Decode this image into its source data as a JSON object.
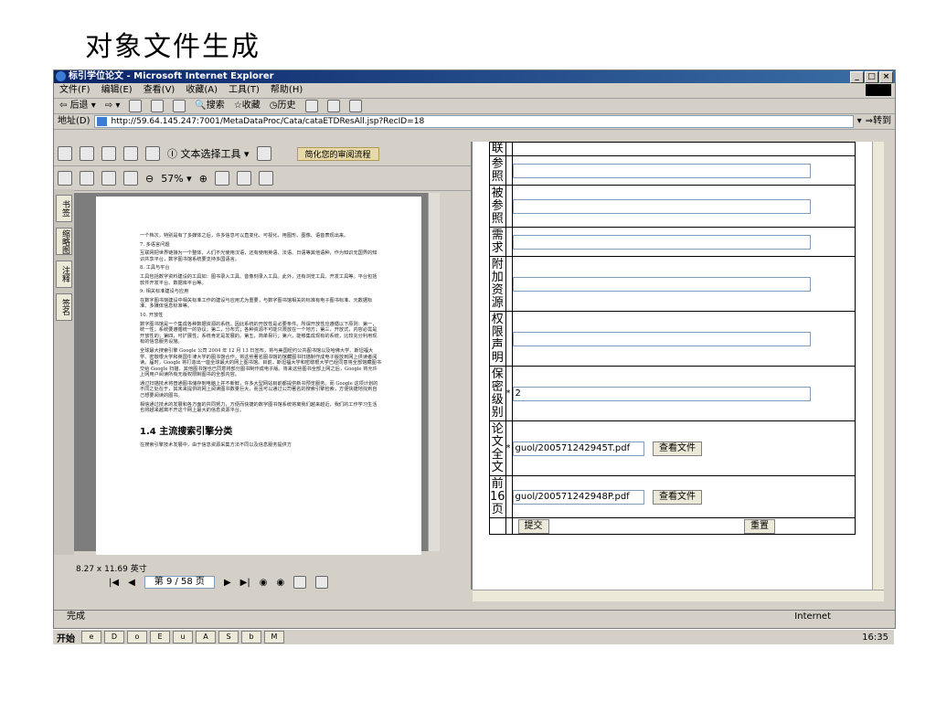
{
  "slide": {
    "title": "对象文件生成"
  },
  "window": {
    "title": "标引学位论文 - Microsoft Internet Explorer",
    "controls": [
      "_",
      "□",
      "×"
    ]
  },
  "menu": [
    "文件(F)",
    "编辑(E)",
    "查看(V)",
    "收藏(A)",
    "工具(T)",
    "帮助(H)"
  ],
  "nav_toolbar": {
    "back": "后退",
    "search": "搜索",
    "favorites": "收藏",
    "history": "历史"
  },
  "address": {
    "label": "地址(D)",
    "url": "http://59.64.145.247:7001/MetaDataProc/Cata/cataETDResAll.jsp?RecID=18",
    "go": "转到"
  },
  "acrobat": {
    "select_tool": "文本选择工具",
    "slogan": "简化您的审阅流程",
    "zoom": "57%",
    "tabs": [
      "书签",
      "缩略图",
      "注释",
      "签名"
    ],
    "page_size": "8.27 x 11.69 英寸",
    "page_indicator": "第 9 / 58 页",
    "page_paragraphs": [
      "一个档次，特别是有了多媒体之后，许多信息可以直变化、可视化，用图形、图像、语音表现出来。",
      "7. 多语言问题",
      "互联网把世界链接为一个整体，人们不光使用汉语，还有使用英语、法语、日语等其他语种，作为知识无国界的知识共享平台，数字图书馆系统要支持多国语言。",
      "8. 工具与平台",
      "工具包括数字资料建设的工具如：图书录入工具、音像刻录入工具。此外，还有浏览工具、开发工具等。平台包括软件开发平台、数据库平台等。",
      "9. 相关标准建设与应用",
      "在数字图书馆建设中相关标准工作的建设与应用尤为重要，与数字图书馆相关的标准有电子图书标准、元数据标准、多媒体信息标准等。",
      "10. 开放性",
      "数字图书馆是一个集成各种数据资源的系统，因此系统的开放性是必要条件。所谓开放性应遵循以下原则：第一，统一性；系统要遵循统一的协议；第二，分布式；各种资源不可能只限放在一个地方；第三，开放式，内容必需是开放性的；第四，可扩展性；系统肯定是发展的。第五，简单易行；第六，能够集成现有的系统，比较充分利用现有的信息服务设施。",
      "全球最大搜索引擎 Google 公司 2004 年 12 月 13 日宣布，将与美国纽约公共图书馆以及哈佛大学、斯坦福大学、密歇根大学和英国牛津大学的图书馆合作，将这些著名图书馆的馆藏图书扫描制作成电子版放到网上供读者阅读。届时，Google 将打造出一座全球最大的网上图书馆。目前，斯坦福大学和密歇根大学已经同意将全部馆藏图书交给 Google 扫描，其他图书馆也已同意将部分图书制作成电子版。将来这些图书全部上网之后，Google 将允许上网用户阅读所有无版权限制图书的全部内容。",
      "通过扫描技术将普通图书储存到电脑上并不新鲜，许多大型网站目前都提供新书预览服务。而 Google 这项计划的不同之处在于，其未来提供的网上阅读图书数量巨大，而且可以通过公司著名的搜索引擎检索，方便快捷地找到自己想要阅读的图书。",
      "相信通过技术的发展和各方面的共同努力，方便而快捷的数字图书馆系统将离我们越来越近，我们的工作学习生活也将越来越离不开这个网上最大的信息资源平台。"
    ],
    "page_heading": "1.4 主流搜索引擎分类",
    "page_footer_line": "在搜索引擎技术发展中，由于信息资源采集方法不同以及信息服务提供方"
  },
  "form": {
    "rows": [
      {
        "label": "联",
        "required": false,
        "value": "",
        "partial": true
      },
      {
        "label": "参照",
        "required": false,
        "value": ""
      },
      {
        "label": "被参照",
        "required": false,
        "value": ""
      },
      {
        "label": "需求",
        "required": false,
        "value": ""
      },
      {
        "label": "附加资源",
        "required": false,
        "value": ""
      },
      {
        "label": "权限声明",
        "required": false,
        "value": ""
      },
      {
        "label": "保密级别",
        "required": true,
        "value": "2"
      }
    ],
    "files": [
      {
        "label": "论文全文",
        "required": true,
        "value": "guol/200571242945T.pdf",
        "button": "查看文件"
      },
      {
        "label": "前16页",
        "required": false,
        "value": "guol/200571242948P.pdf",
        "button": "查看文件"
      }
    ],
    "submit": "提交",
    "reset": "重置"
  },
  "status": {
    "text": "完成",
    "zone": "Internet"
  },
  "taskbar": {
    "start": "开始",
    "clock": "16:35"
  }
}
